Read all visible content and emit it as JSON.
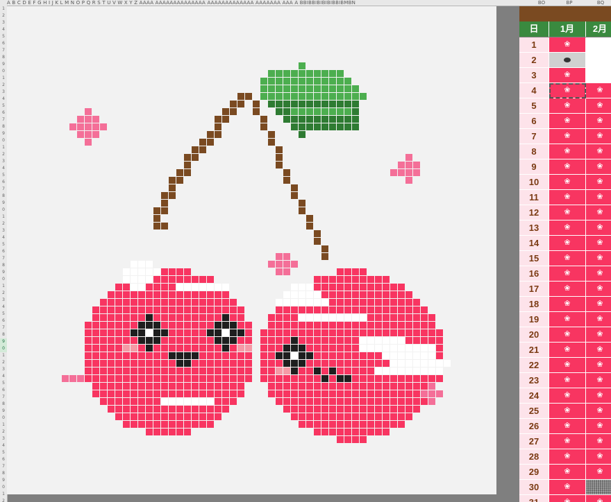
{
  "sheet": {
    "column_letters": "A B C D E F G H I J K L M N O P Q R S T U V W X Y Z AAAA AAAAAAAAAAAAAA AAAAAAAAAAAAA AAAAAAA AAA A BBIBBIBIBIBIBBIBMBN",
    "column_headers": {
      "bo": "BO",
      "bp": "BP",
      "bq": "BQ"
    },
    "row_numbers": [
      "1",
      "2",
      "3",
      "4",
      "5",
      "6",
      "7",
      "8",
      "9",
      "0",
      "1",
      "2",
      "3",
      "4",
      "5",
      "6",
      "7",
      "8",
      "9",
      "0",
      "1",
      "2",
      "3",
      "4",
      "5",
      "6",
      "7",
      "8",
      "9",
      "0",
      "1",
      "2",
      "3",
      "4",
      "5",
      "6",
      "7",
      "8",
      "9",
      "0",
      "1",
      "2",
      "3",
      "4",
      "5",
      "6",
      "7",
      "8",
      "9",
      "0",
      "1",
      "2",
      "3",
      "4",
      "5",
      "6",
      "7",
      "8",
      "9",
      "0",
      "1",
      "2",
      "3",
      "4",
      "5",
      "6",
      "7",
      "8",
      "9",
      "0",
      "1",
      "2"
    ]
  },
  "calendar": {
    "day_header": "日",
    "month1_header": "1月",
    "month2_header": "2月",
    "days": [
      "1",
      "2",
      "3",
      "4",
      "5",
      "6",
      "7",
      "8",
      "9",
      "10",
      "11",
      "12",
      "13",
      "14",
      "15",
      "16",
      "17",
      "18",
      "19",
      "20",
      "21",
      "22",
      "23",
      "24",
      "25",
      "26",
      "27",
      "28",
      "29",
      "30",
      "31"
    ],
    "icon": "cherry-icon",
    "colors": {
      "header_green": "#3a8a3f",
      "brown_band": "#7a4a21",
      "day_bg": "#fde3ea",
      "cherry_red": "#f83561"
    }
  },
  "pixel_art": {
    "colors": {
      "red": "#f83561",
      "white": "#ffffff",
      "pink": "#f46f98",
      "black": "#1e1e1e",
      "blush": "#f59aa6",
      "stem": "#7a4a21",
      "leaf_light": "#4cae4f",
      "leaf_dark": "#2e7b32",
      "background": "#f2f2f2"
    }
  }
}
